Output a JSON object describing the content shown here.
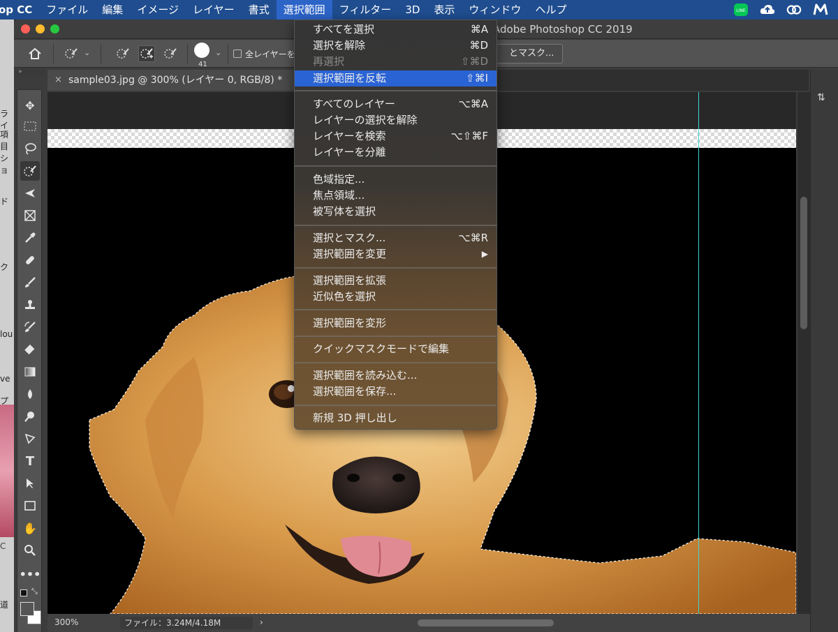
{
  "menubar": {
    "app_name": "op CC",
    "items": [
      "ファイル",
      "編集",
      "イメージ",
      "レイヤー",
      "書式",
      "選択範囲",
      "フィルター",
      "3D",
      "表示",
      "ウィンドウ",
      "ヘルプ"
    ],
    "active_item": "選択範囲",
    "tray_icons": [
      "line-icon",
      "cloud-upload-icon",
      "creative-cloud-icon",
      "m-app-icon"
    ],
    "line_label": "LINE"
  },
  "window": {
    "title": "Adobe Photoshop CC 2019"
  },
  "options_bar": {
    "brush_size": "41",
    "sample_all_layers_label": "全レイヤーを",
    "select_and_mask_label": "とマスク..."
  },
  "document": {
    "tab_title": "sample03.jpg @ 300% (レイヤー 0, RGB/8) *",
    "tab_close": "×"
  },
  "status": {
    "zoom": "300%",
    "file_info": "ファイル：3.24M/4.18M",
    "arrow": "›"
  },
  "select_menu": {
    "groups": [
      [
        {
          "label": "すべてを選択",
          "shortcut": "⌘A",
          "state": "normal"
        },
        {
          "label": "選択を解除",
          "shortcut": "⌘D",
          "state": "normal"
        },
        {
          "label": "再選択",
          "shortcut": "⇧⌘D",
          "state": "disabled"
        },
        {
          "label": "選択範囲を反転",
          "shortcut": "⇧⌘I",
          "state": "highlighted"
        }
      ],
      [
        {
          "label": "すべてのレイヤー",
          "shortcut": "⌥⌘A",
          "state": "normal"
        },
        {
          "label": "レイヤーの選択を解除",
          "shortcut": "",
          "state": "normal"
        },
        {
          "label": "レイヤーを検索",
          "shortcut": "⌥⇧⌘F",
          "state": "normal"
        },
        {
          "label": "レイヤーを分離",
          "shortcut": "",
          "state": "normal"
        }
      ],
      [
        {
          "label": "色域指定...",
          "shortcut": "",
          "state": "normal"
        },
        {
          "label": "焦点領域...",
          "shortcut": "",
          "state": "normal"
        },
        {
          "label": "被写体を選択",
          "shortcut": "",
          "state": "normal"
        }
      ],
      [
        {
          "label": "選択とマスク...",
          "shortcut": "⌥⌘R",
          "state": "normal"
        },
        {
          "label": "選択範囲を変更",
          "shortcut": "▶",
          "state": "normal"
        }
      ],
      [
        {
          "label": "選択範囲を拡張",
          "shortcut": "",
          "state": "normal"
        },
        {
          "label": "近似色を選択",
          "shortcut": "",
          "state": "normal"
        }
      ],
      [
        {
          "label": "選択範囲を変形",
          "shortcut": "",
          "state": "normal"
        }
      ],
      [
        {
          "label": "クイックマスクモードで編集",
          "shortcut": "",
          "state": "normal"
        }
      ],
      [
        {
          "label": "選択範囲を読み込む...",
          "shortcut": "",
          "state": "normal"
        },
        {
          "label": "選択範囲を保存...",
          "shortcut": "",
          "state": "normal"
        }
      ],
      [
        {
          "label": "新規 3D 押し出し",
          "shortcut": "",
          "state": "normal"
        }
      ]
    ]
  },
  "desktop_fragments": [
    "ライ",
    "項目",
    "ショ",
    "ド",
    "ク",
    "lou",
    "ve",
    "プ",
    "C",
    "道"
  ],
  "colors": {
    "menubar_bg": "#1f4d8f",
    "highlight": "#2a63d4",
    "guide": "#3fd2d2",
    "line_green": "#06c755"
  }
}
